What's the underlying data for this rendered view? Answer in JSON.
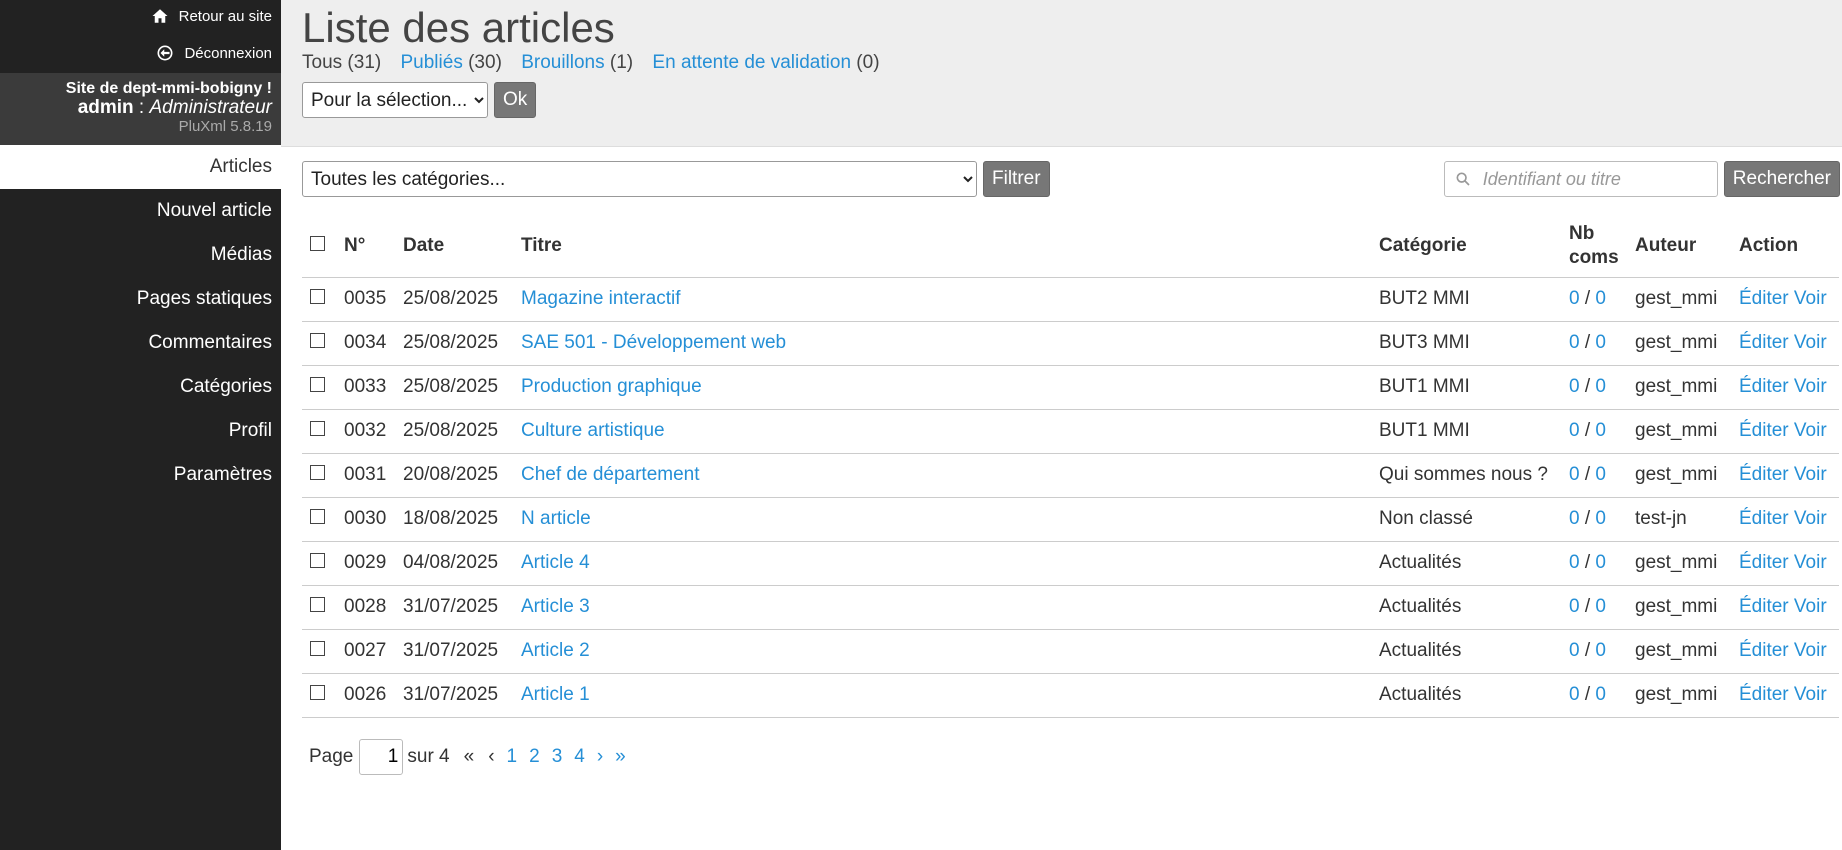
{
  "sidebar": {
    "back_to_site": "Retour au site",
    "logout": "Déconnexion",
    "site_name": "Site de dept-mmi-bobigny !",
    "user_name": "admin",
    "user_sep": " : ",
    "user_role": "Administrateur",
    "version": "PluXml 5.8.19",
    "items": [
      {
        "label": "Articles"
      },
      {
        "label": "Nouvel article"
      },
      {
        "label": "Médias"
      },
      {
        "label": "Pages statiques"
      },
      {
        "label": "Commentaires"
      },
      {
        "label": "Catégories"
      },
      {
        "label": "Profil"
      },
      {
        "label": "Paramètres"
      }
    ]
  },
  "header": {
    "title": "Liste des articles",
    "filters": [
      {
        "label": "Tous",
        "count": "(31)"
      },
      {
        "label": "Publiés",
        "count": "(30)"
      },
      {
        "label": "Brouillons",
        "count": "(1)"
      },
      {
        "label": "En attente de validation",
        "count": "(0)"
      }
    ],
    "bulk_select": "Pour la sélection...",
    "ok_button": "Ok"
  },
  "filter": {
    "category_select": "Toutes les catégories...",
    "filter_button": "Filtrer",
    "search_placeholder": "Identifiant ou titre",
    "search_button": "Rechercher"
  },
  "table": {
    "headers": {
      "num": "N°",
      "date": "Date",
      "title": "Titre",
      "category": "Catégorie",
      "coms_line1": "Nb",
      "coms_line2": "coms",
      "author": "Auteur",
      "action": "Action"
    },
    "rows": [
      {
        "num": "0035",
        "date": "25/08/2025",
        "title": "Magazine interactif",
        "category": "BUT2 MMI",
        "c1": "0",
        "c2": "0",
        "author": "gest_mmi"
      },
      {
        "num": "0034",
        "date": "25/08/2025",
        "title": "SAE 501 - Développement web",
        "category": "BUT3 MMI",
        "c1": "0",
        "c2": "0",
        "author": "gest_mmi"
      },
      {
        "num": "0033",
        "date": "25/08/2025",
        "title": "Production graphique",
        "category": "BUT1 MMI",
        "c1": "0",
        "c2": "0",
        "author": "gest_mmi"
      },
      {
        "num": "0032",
        "date": "25/08/2025",
        "title": "Culture artistique",
        "category": "BUT1 MMI",
        "c1": "0",
        "c2": "0",
        "author": "gest_mmi"
      },
      {
        "num": "0031",
        "date": "20/08/2025",
        "title": "Chef de département",
        "category": "Qui sommes nous ?",
        "c1": "0",
        "c2": "0",
        "author": "gest_mmi"
      },
      {
        "num": "0030",
        "date": "18/08/2025",
        "title": "N article",
        "category": "Non classé",
        "c1": "0",
        "c2": "0",
        "author": "test-jn"
      },
      {
        "num": "0029",
        "date": "04/08/2025",
        "title": "Article 4",
        "category": "Actualités",
        "c1": "0",
        "c2": "0",
        "author": "gest_mmi"
      },
      {
        "num": "0028",
        "date": "31/07/2025",
        "title": "Article 3",
        "category": "Actualités",
        "c1": "0",
        "c2": "0",
        "author": "gest_mmi"
      },
      {
        "num": "0027",
        "date": "31/07/2025",
        "title": "Article 2",
        "category": "Actualités",
        "c1": "0",
        "c2": "0",
        "author": "gest_mmi"
      },
      {
        "num": "0026",
        "date": "31/07/2025",
        "title": "Article 1",
        "category": "Actualités",
        "c1": "0",
        "c2": "0",
        "author": "gest_mmi"
      }
    ],
    "edit_label": "Éditer",
    "view_label": "Voir",
    "coms_sep": "/"
  },
  "pagination": {
    "page_label": "Page",
    "current": "1",
    "of_label": "sur 4",
    "first": "«",
    "prev": "‹",
    "pages": [
      "1",
      "2",
      "3",
      "4"
    ],
    "next": "›",
    "last": "»"
  },
  "colors": {
    "sidebar_bg": "#222222",
    "header_bg": "#eeeeee",
    "link": "#258fd6",
    "button_bg": "#777777"
  }
}
